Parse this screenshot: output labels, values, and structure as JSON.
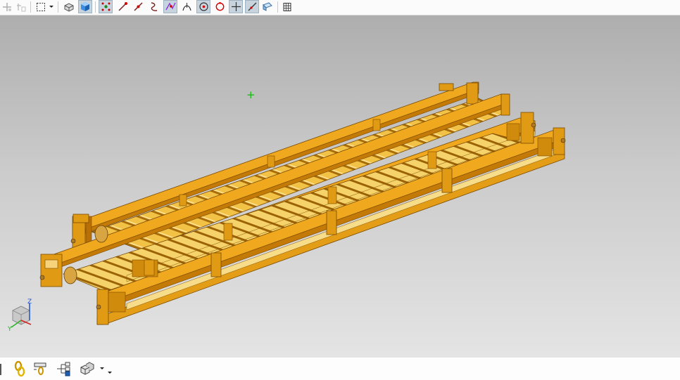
{
  "top_toolbar": {
    "buttons": [
      {
        "id": "snap-point",
        "icon": "snap-point-icon",
        "state": "disabled"
      },
      {
        "id": "snap-offset",
        "icon": "snap-offset-icon",
        "state": "disabled"
      },
      {
        "id": "select-box",
        "icon": "selection-rectangle-icon",
        "state": "normal"
      },
      {
        "id": "shaded-edges",
        "icon": "shaded-with-edges-icon",
        "state": "normal"
      },
      {
        "id": "shaded",
        "icon": "shaded-cube-icon",
        "state": "pressed"
      },
      {
        "id": "snap-all",
        "icon": "snap-all-points-icon",
        "state": "pressed"
      },
      {
        "id": "snap-endpoint",
        "icon": "endpoint-icon",
        "state": "normal"
      },
      {
        "id": "snap-midpoint",
        "icon": "midpoint-icon",
        "state": "normal"
      },
      {
        "id": "snap-control",
        "icon": "control-point-icon",
        "state": "normal"
      },
      {
        "id": "snap-intersection",
        "icon": "intersection-icon",
        "state": "pressed"
      },
      {
        "id": "snap-tangent",
        "icon": "tangent-icon",
        "state": "normal"
      },
      {
        "id": "snap-arc-center",
        "icon": "arc-center-icon",
        "state": "pressed"
      },
      {
        "id": "snap-quadrant",
        "icon": "quadrant-icon",
        "state": "normal"
      },
      {
        "id": "snap-existing",
        "icon": "existing-point-icon",
        "state": "pressed"
      },
      {
        "id": "snap-on-curve",
        "icon": "point-on-curve-icon",
        "state": "pressed"
      },
      {
        "id": "snap-on-face",
        "icon": "point-on-face-icon",
        "state": "normal"
      },
      {
        "id": "grid",
        "icon": "grid-icon",
        "state": "normal"
      }
    ]
  },
  "viewport": {
    "model": "roller-conveyor-frame-assembly",
    "model_color": "#e8a317",
    "background_top": "#aeaeae",
    "background_bottom": "#e4e4e4",
    "cursor_marker": "+",
    "triad": {
      "z_label": "Z",
      "y_label": "Y"
    }
  },
  "bottom_toolbar": {
    "buttons": [
      {
        "id": "assembly-constraints",
        "icon": "chain-link-icon"
      },
      {
        "id": "move-component",
        "icon": "move-component-icon"
      },
      {
        "id": "assembly-navigator",
        "icon": "assembly-tree-icon"
      },
      {
        "id": "add-component",
        "icon": "add-component-icon"
      }
    ]
  }
}
